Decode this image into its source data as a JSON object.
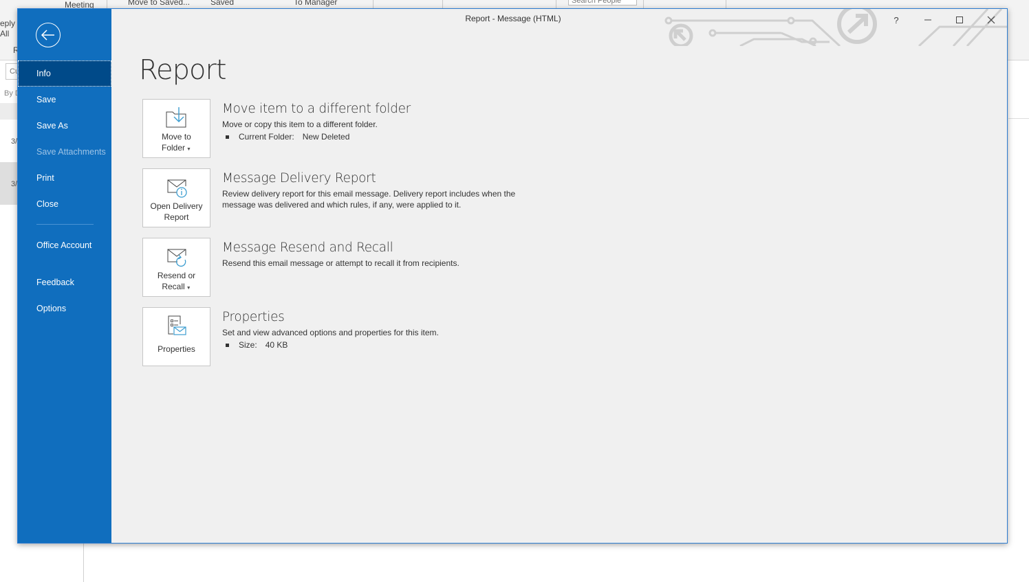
{
  "background_app": {
    "ribbon_fragments": [
      "eply",
      "All",
      "Meeting",
      "Move to Saved...",
      "Saved",
      "To Manager",
      "Search People",
      "R"
    ],
    "list_filter_text": "Cu",
    "list_sort_text": "By D",
    "list_rows": [
      "3/",
      "3/"
    ]
  },
  "window": {
    "title": "Report  -  Message (HTML)",
    "controls": {
      "help": "?",
      "minimize": "–",
      "maximize": "□",
      "close": "✕"
    }
  },
  "nav": {
    "back_icon": "back-arrow-icon",
    "items": [
      {
        "label": "Info",
        "state": "active"
      },
      {
        "label": "Save",
        "state": "normal"
      },
      {
        "label": "Save As",
        "state": "normal"
      },
      {
        "label": "Save Attachments",
        "state": "disabled"
      },
      {
        "label": "Print",
        "state": "normal"
      },
      {
        "label": "Close",
        "state": "normal"
      },
      {
        "label": "Office Account",
        "state": "normal"
      },
      {
        "label": "Feedback",
        "state": "normal"
      },
      {
        "label": "Options",
        "state": "normal"
      }
    ]
  },
  "page": {
    "title": "Report",
    "sections": [
      {
        "tile_label_line1": "Move to",
        "tile_label_line2": "Folder",
        "tile_has_dropdown": true,
        "icon": "move-to-folder-icon",
        "title": "Move item to a different folder",
        "description": "Move or copy this item to a different folder.",
        "bullet_label": "Current Folder:",
        "bullet_value": "New Deleted"
      },
      {
        "tile_label_line1": "Open Delivery",
        "tile_label_line2": "Report",
        "tile_has_dropdown": false,
        "icon": "delivery-report-icon",
        "title": "Message Delivery Report",
        "description": "Review delivery report for this email message. Delivery report includes when the message was delivered and which rules, if any, were applied to it."
      },
      {
        "tile_label_line1": "Resend or",
        "tile_label_line2": "Recall",
        "tile_has_dropdown": true,
        "icon": "resend-recall-icon",
        "title": "Message Resend and Recall",
        "description": "Resend this email message or attempt to recall it from recipients."
      },
      {
        "tile_label_line1": "Properties",
        "tile_label_line2": "",
        "tile_has_dropdown": false,
        "icon": "properties-icon",
        "title": "Properties",
        "description": "Set and view advanced options and properties for this item.",
        "bullet_label": "Size:",
        "bullet_value": "40 KB"
      }
    ]
  },
  "colors": {
    "nav_background": "#106ebe",
    "nav_active": "#004a89",
    "content_background": "#f0f0f0",
    "icon_accent": "#3c9dd0"
  }
}
